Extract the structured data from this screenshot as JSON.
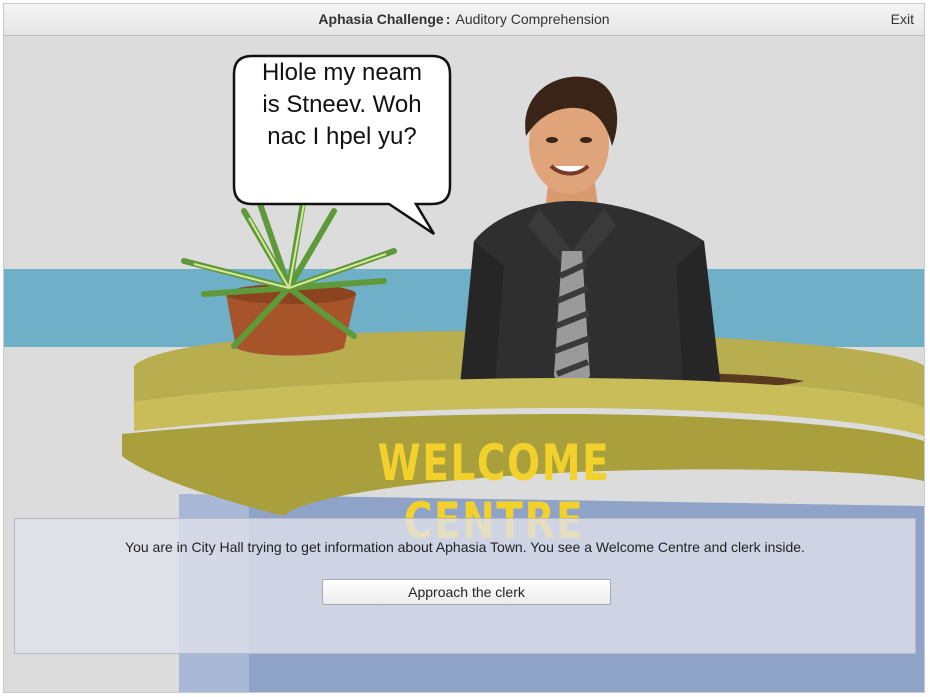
{
  "window": {
    "title_bold": "Aphasia Challenge",
    "title_separator": ":",
    "title_rest": "Auditory Comprehension",
    "exit_label": "Exit"
  },
  "scene": {
    "speech_bubble": [
      "Hlole my neam",
      "is Stneev. Woh",
      "nac I hpel yu?"
    ],
    "sign_text": "WELCOME CENTRE"
  },
  "panel": {
    "description": "You are in City Hall trying to get information about Aphasia Town. You see a Welcome Centre and clerk inside.",
    "button_label": "Approach the clerk"
  },
  "colors": {
    "wall": "#dcdcdc",
    "stripe": "#6fb0c8",
    "desk_top": "#b8ad4f",
    "desk_front": "#a99f3c",
    "desk_base": "#8fa3c9",
    "sign_text": "#f2d12c",
    "pot": "#a8542a",
    "shirt": "#2f2f2f"
  }
}
